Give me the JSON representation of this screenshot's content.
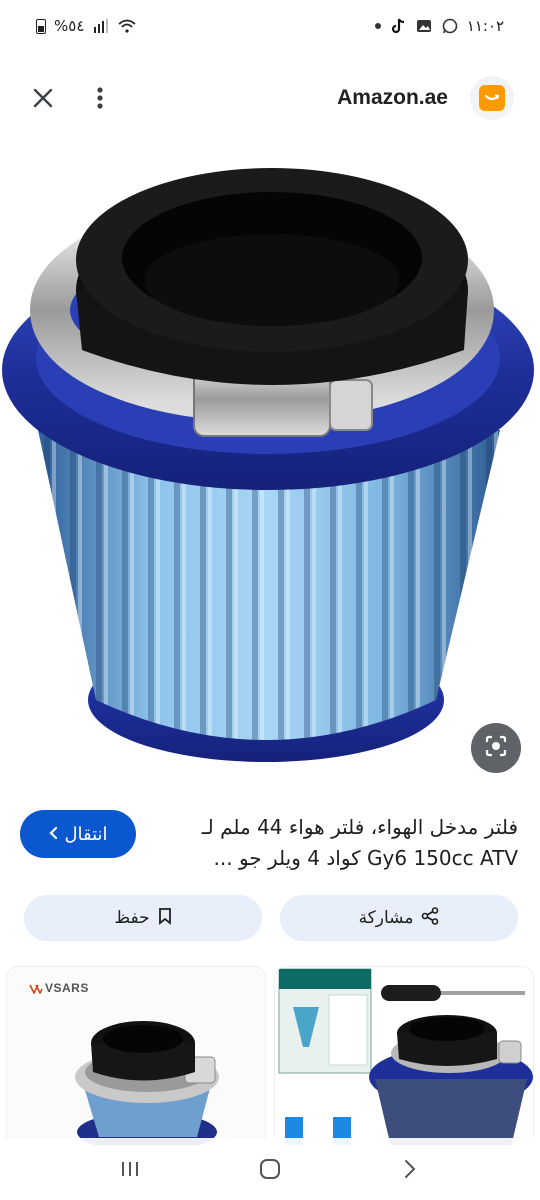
{
  "status_bar": {
    "time": "١١:٠٢",
    "battery": "%٥٤"
  },
  "header": {
    "site_name": "Amazon.ae"
  },
  "product": {
    "title_line1": "فلتر مدخل الهواء، فلتر هواء 44 ملم لـ",
    "title_line2": "Gy6 150cc ATV كواد 4 ويلر جو ...",
    "visit_label": "انتقال"
  },
  "actions": {
    "share_label": "مشاركة",
    "save_label": "حفظ"
  },
  "related": {
    "card1_brand": "VSARS"
  },
  "colors": {
    "accent": "#0b57d0",
    "favicon": "#ff9900",
    "action_bg": "#e8eefa"
  }
}
